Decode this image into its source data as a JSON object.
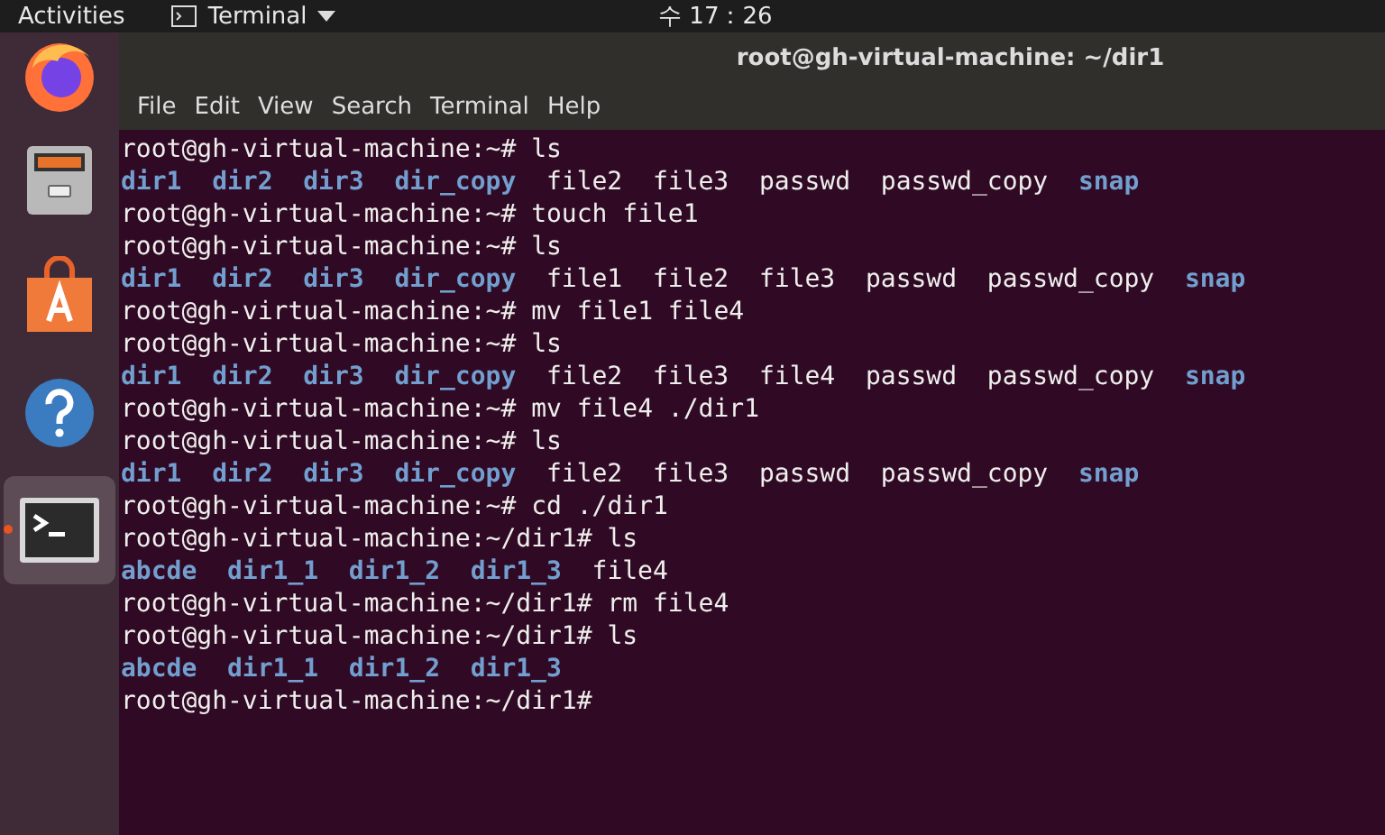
{
  "top_bar": {
    "activities": "Activities",
    "app_menu": "Terminal",
    "clock": "수 17：26"
  },
  "dock": {
    "items": [
      {
        "kind": "browser",
        "selected": false,
        "running": false
      },
      {
        "kind": "files",
        "selected": false,
        "running": false
      },
      {
        "kind": "store",
        "selected": false,
        "running": false
      },
      {
        "kind": "help",
        "selected": false,
        "running": false
      },
      {
        "kind": "terminal",
        "selected": true,
        "running": true
      }
    ]
  },
  "window": {
    "title": "root@gh-virtual-machine: ~/dir1",
    "menu": [
      "File",
      "Edit",
      "View",
      "Search",
      "Terminal",
      "Help"
    ]
  },
  "terminal": {
    "lines": [
      {
        "kind": "prompt",
        "text": "root@gh-virtual-machine:~# ls"
      },
      {
        "kind": "listing",
        "entries": [
          {
            "name": "dir1",
            "kind": "dir"
          },
          {
            "name": "dir2",
            "kind": "dir"
          },
          {
            "name": "dir3",
            "kind": "dir"
          },
          {
            "name": "dir_copy",
            "kind": "dir"
          },
          {
            "name": "file2",
            "kind": "file"
          },
          {
            "name": "file3",
            "kind": "file"
          },
          {
            "name": "passwd",
            "kind": "file"
          },
          {
            "name": "passwd_copy",
            "kind": "file"
          },
          {
            "name": "snap",
            "kind": "dir"
          }
        ]
      },
      {
        "kind": "prompt",
        "text": "root@gh-virtual-machine:~# touch file1"
      },
      {
        "kind": "prompt",
        "text": "root@gh-virtual-machine:~# ls"
      },
      {
        "kind": "listing",
        "entries": [
          {
            "name": "dir1",
            "kind": "dir"
          },
          {
            "name": "dir2",
            "kind": "dir"
          },
          {
            "name": "dir3",
            "kind": "dir"
          },
          {
            "name": "dir_copy",
            "kind": "dir"
          },
          {
            "name": "file1",
            "kind": "file"
          },
          {
            "name": "file2",
            "kind": "file"
          },
          {
            "name": "file3",
            "kind": "file"
          },
          {
            "name": "passwd",
            "kind": "file"
          },
          {
            "name": "passwd_copy",
            "kind": "file"
          },
          {
            "name": "snap",
            "kind": "dir"
          }
        ]
      },
      {
        "kind": "prompt",
        "text": "root@gh-virtual-machine:~# mv file1 file4"
      },
      {
        "kind": "prompt",
        "text": "root@gh-virtual-machine:~# ls"
      },
      {
        "kind": "listing",
        "entries": [
          {
            "name": "dir1",
            "kind": "dir"
          },
          {
            "name": "dir2",
            "kind": "dir"
          },
          {
            "name": "dir3",
            "kind": "dir"
          },
          {
            "name": "dir_copy",
            "kind": "dir"
          },
          {
            "name": "file2",
            "kind": "file"
          },
          {
            "name": "file3",
            "kind": "file"
          },
          {
            "name": "file4",
            "kind": "file"
          },
          {
            "name": "passwd",
            "kind": "file"
          },
          {
            "name": "passwd_copy",
            "kind": "file"
          },
          {
            "name": "snap",
            "kind": "dir"
          }
        ]
      },
      {
        "kind": "prompt",
        "text": "root@gh-virtual-machine:~# mv file4 ./dir1"
      },
      {
        "kind": "prompt",
        "text": "root@gh-virtual-machine:~# ls"
      },
      {
        "kind": "listing",
        "entries": [
          {
            "name": "dir1",
            "kind": "dir"
          },
          {
            "name": "dir2",
            "kind": "dir"
          },
          {
            "name": "dir3",
            "kind": "dir"
          },
          {
            "name": "dir_copy",
            "kind": "dir"
          },
          {
            "name": "file2",
            "kind": "file"
          },
          {
            "name": "file3",
            "kind": "file"
          },
          {
            "name": "passwd",
            "kind": "file"
          },
          {
            "name": "passwd_copy",
            "kind": "file"
          },
          {
            "name": "snap",
            "kind": "dir"
          }
        ]
      },
      {
        "kind": "prompt",
        "text": "root@gh-virtual-machine:~# cd ./dir1"
      },
      {
        "kind": "prompt",
        "text": "root@gh-virtual-machine:~/dir1# ls"
      },
      {
        "kind": "listing",
        "entries": [
          {
            "name": "abcde",
            "kind": "dir"
          },
          {
            "name": "dir1_1",
            "kind": "dir"
          },
          {
            "name": "dir1_2",
            "kind": "dir"
          },
          {
            "name": "dir1_3",
            "kind": "dir"
          },
          {
            "name": "file4",
            "kind": "file"
          }
        ]
      },
      {
        "kind": "prompt",
        "text": "root@gh-virtual-machine:~/dir1# rm file4"
      },
      {
        "kind": "prompt",
        "text": "root@gh-virtual-machine:~/dir1# ls"
      },
      {
        "kind": "listing",
        "entries": [
          {
            "name": "abcde",
            "kind": "dir"
          },
          {
            "name": "dir1_1",
            "kind": "dir"
          },
          {
            "name": "dir1_2",
            "kind": "dir"
          },
          {
            "name": "dir1_3",
            "kind": "dir"
          }
        ]
      },
      {
        "kind": "prompt",
        "text": "root@gh-virtual-machine:~/dir1#"
      }
    ]
  }
}
